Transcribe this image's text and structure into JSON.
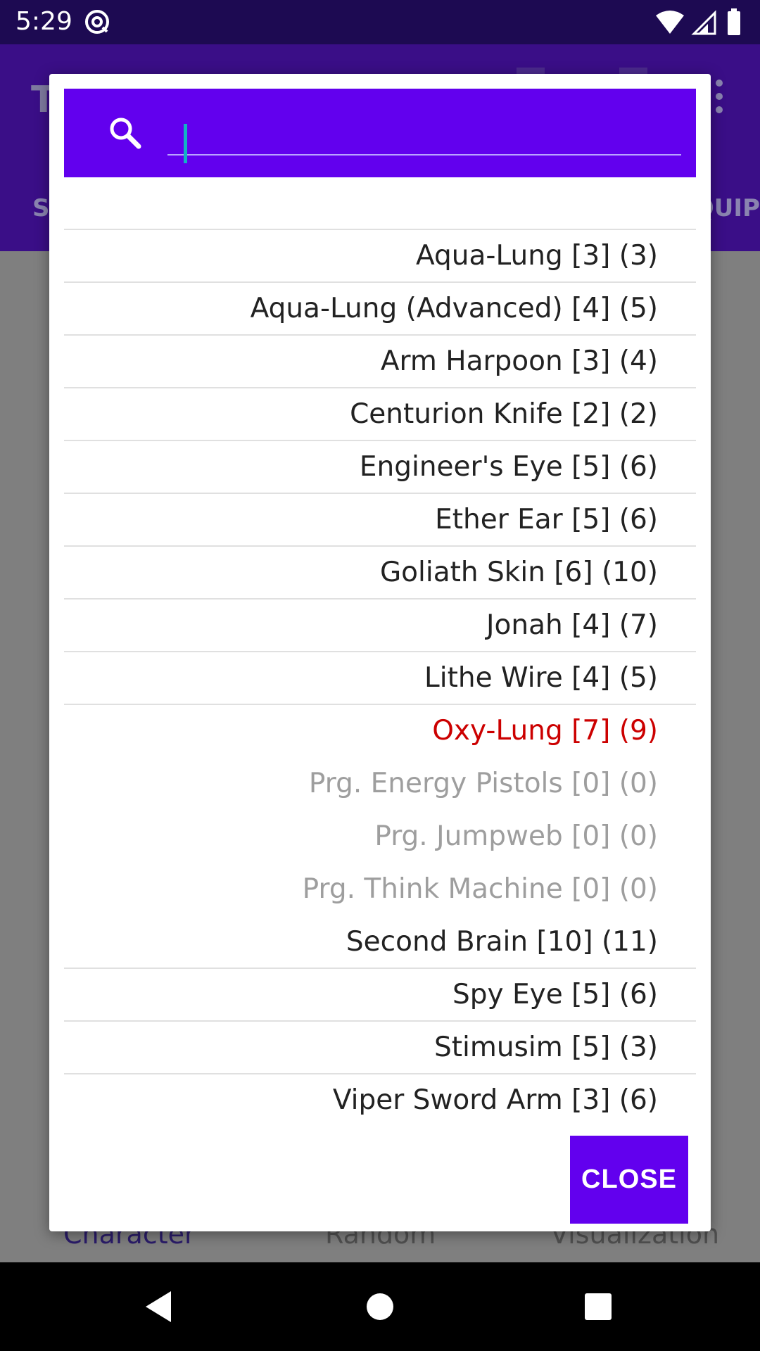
{
  "status_bar": {
    "time": "5:29",
    "icons": [
      "at-icon",
      "wifi-icon",
      "signal-icon",
      "battery-icon"
    ]
  },
  "background_app": {
    "title": "T",
    "tab_left": "S",
    "tab_right": "QUIP",
    "bottom_nav": {
      "character": "Character",
      "random": "Random",
      "visualization": "Visualization"
    }
  },
  "dialog": {
    "search": {
      "value": "",
      "placeholder": ""
    },
    "items": [
      {
        "label": "Aqua-Lung [3] (3)",
        "state": "normal"
      },
      {
        "label": "Aqua-Lung (Advanced) [4] (5)",
        "state": "normal"
      },
      {
        "label": "Arm Harpoon [3] (4)",
        "state": "normal"
      },
      {
        "label": "Centurion Knife [2] (2)",
        "state": "normal"
      },
      {
        "label": "Engineer's Eye [5] (6)",
        "state": "normal"
      },
      {
        "label": "Ether Ear [5] (6)",
        "state": "normal"
      },
      {
        "label": "Goliath Skin [6] (10)",
        "state": "normal"
      },
      {
        "label": "Jonah [4] (7)",
        "state": "normal"
      },
      {
        "label": "Lithe Wire [4] (5)",
        "state": "normal"
      },
      {
        "label": "Oxy-Lung [7] (9)",
        "state": "highlight"
      },
      {
        "label": "Prg. Energy Pistols [0] (0)",
        "state": "disabled"
      },
      {
        "label": "Prg. Jumpweb [0] (0)",
        "state": "disabled"
      },
      {
        "label": "Prg. Think Machine [0] (0)",
        "state": "disabled"
      },
      {
        "label": "Second Brain [10] (11)",
        "state": "normal"
      },
      {
        "label": "Spy Eye [5] (6)",
        "state": "normal"
      },
      {
        "label": "Stimusim [5] (3)",
        "state": "normal"
      },
      {
        "label": "Viper Sword Arm [3] (6)",
        "state": "normal"
      }
    ],
    "close_label": "CLOSE"
  },
  "colors": {
    "accent": "#6200ee",
    "highlight": "#cc0000",
    "disabled": "#9e9e9e"
  }
}
